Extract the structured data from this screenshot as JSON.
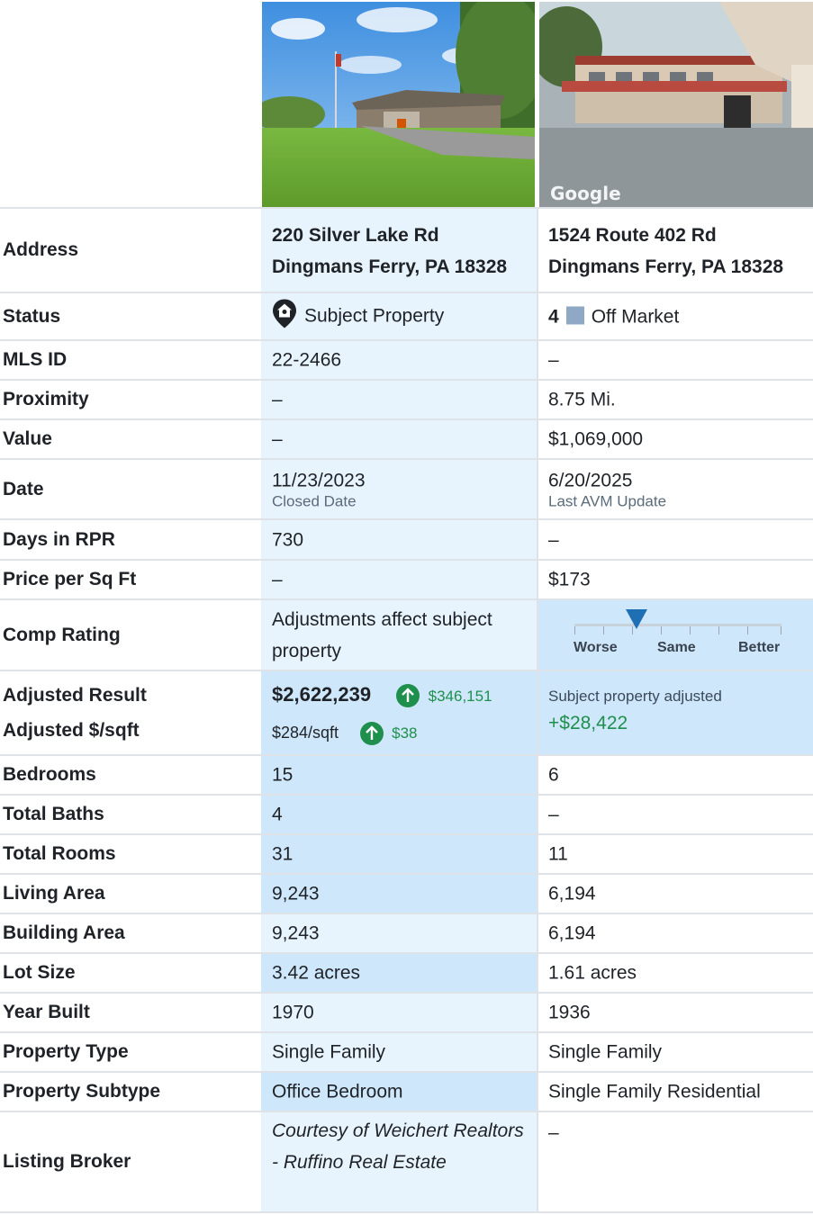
{
  "subject": {
    "address_line1": "220 Silver Lake Rd",
    "address_line2": "Dingmans Ferry, PA 18328",
    "status": "Subject Property",
    "mls_id": "22-2466",
    "proximity": "–",
    "value": "–",
    "date": "11/23/2023",
    "date_label": "Closed Date",
    "days_in_rpr": "730",
    "price_per_sqft": "–",
    "comp_rating": "Adjustments affect subject property",
    "adjusted_result": "$2,622,239",
    "adjusted_result_change": "$346,151",
    "adjusted_sqft": "$284/sqft",
    "adjusted_sqft_change": "$38",
    "bedrooms": "15",
    "total_baths": "4",
    "total_rooms": "31",
    "living_area": "9,243",
    "building_area": "9,243",
    "lot_size": "3.42 acres",
    "year_built": "1970",
    "property_type": "Single Family",
    "property_subtype": "Office Bedroom",
    "listing_broker": "Courtesy of Weichert Realtors - Ruffino Real Estate"
  },
  "comp": {
    "address_line1": "1524 Route 402 Rd",
    "address_line2": "Dingmans Ferry, PA 18328",
    "status_number": "4",
    "status": "Off Market",
    "mls_id": "–",
    "proximity": "8.75 Mi.",
    "value": "$1,069,000",
    "date": "6/20/2025",
    "date_label": "Last AVM Update",
    "days_in_rpr": "–",
    "price_per_sqft": "$173",
    "rating_scale": {
      "worse": "Worse",
      "same": "Same",
      "better": "Better",
      "level": 0.3
    },
    "adjusted_note": "Subject property adjusted",
    "adjusted_amount": "+$28,422",
    "bedrooms": "6",
    "total_baths": "–",
    "total_rooms": "11",
    "living_area": "6,194",
    "building_area": "6,194",
    "lot_size": "1.61 acres",
    "year_built": "1936",
    "property_type": "Single Family",
    "property_subtype": "Single Family Residential",
    "listing_broker": "–",
    "photo_watermark": "Google"
  },
  "labels": {
    "address": "Address",
    "status": "Status",
    "mls_id": "MLS ID",
    "proximity": "Proximity",
    "value": "Value",
    "date": "Date",
    "days_in_rpr": "Days in RPR",
    "price_per_sqft": "Price per Sq Ft",
    "comp_rating": "Comp Rating",
    "adjusted_result": "Adjusted Result",
    "adjusted_sqft": "Adjusted $/sqft",
    "bedrooms": "Bedrooms",
    "total_baths": "Total Baths",
    "total_rooms": "Total Rooms",
    "living_area": "Living Area",
    "building_area": "Building Area",
    "lot_size": "Lot Size",
    "year_built": "Year Built",
    "property_type": "Property Type",
    "property_subtype": "Property Subtype",
    "listing_broker": "Listing Broker"
  },
  "colors": {
    "subject_bg": "#e8f4fd",
    "highlight_bg": "#cfe7fa",
    "accent": "#1f6fb5",
    "positive": "#1f8f4e",
    "status_marker": "#8fa8c6"
  }
}
